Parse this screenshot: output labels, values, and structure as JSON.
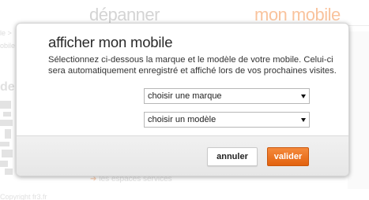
{
  "background": {
    "tab_depanner": "dépanner",
    "tab_mon_mobile": "mon mobile",
    "crumb_1": "le >",
    "crumb_2": "obile",
    "left_heading": "de",
    "footer_link": "les espaces services",
    "footer_brand": "Copyright fr3.fr"
  },
  "modal": {
    "title": "afficher mon mobile",
    "description": "Sélectionnez ci-dessous la marque et le modèle de votre mobile. Celui-ci sera automatiquement enregistré et affiché lors de vos prochaines visites.",
    "brand_select": {
      "selected": "choisir une marque"
    },
    "model_select": {
      "selected": "choisir un modèle"
    },
    "cancel_label": "annuler",
    "submit_label": "valider"
  },
  "colors": {
    "accent_orange": "#f26d1e",
    "tab_active_orange": "#f6a469",
    "text_dark": "#2a2a2a"
  }
}
